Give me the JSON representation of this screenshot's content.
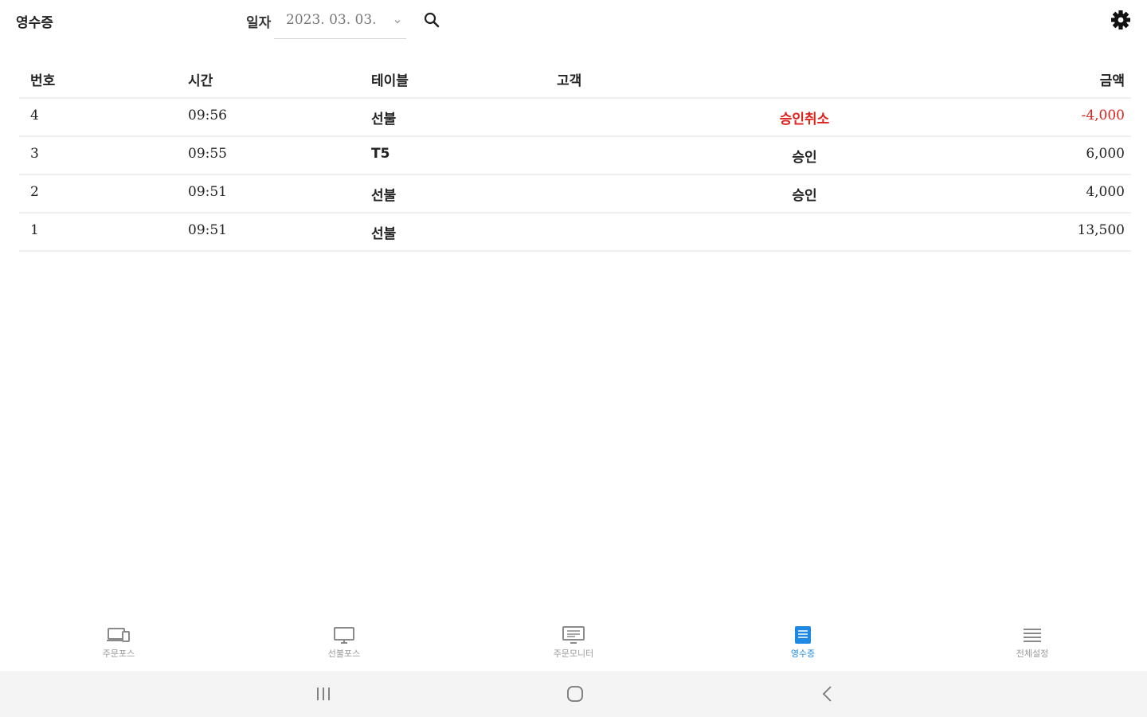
{
  "header": {
    "title": "영수증",
    "date_label": "일자",
    "date_value": "2023. 03. 03."
  },
  "table": {
    "columns": [
      "번호",
      "시간",
      "테이블",
      "고객",
      "금액"
    ],
    "rows": [
      {
        "no": "4",
        "time": "09:56",
        "table": "선불",
        "customer": "",
        "status": "승인취소",
        "amount": "-4,000",
        "cancelled": true
      },
      {
        "no": "3",
        "time": "09:55",
        "table": "T5",
        "customer": "",
        "status": "승인",
        "amount": "6,000",
        "cancelled": false
      },
      {
        "no": "2",
        "time": "09:51",
        "table": "선불",
        "customer": "",
        "status": "승인",
        "amount": "4,000",
        "cancelled": false
      },
      {
        "no": "1",
        "time": "09:51",
        "table": "선불",
        "customer": "",
        "status": "",
        "amount": "13,500",
        "cancelled": false
      }
    ]
  },
  "bottom_nav": {
    "items": [
      {
        "label": "주문포스",
        "icon": "devices-icon",
        "active": false
      },
      {
        "label": "선불포스",
        "icon": "monitor-icon",
        "active": false
      },
      {
        "label": "주문모니터",
        "icon": "order-monitor-icon",
        "active": false
      },
      {
        "label": "영수증",
        "icon": "receipt-icon",
        "active": true
      },
      {
        "label": "전체설정",
        "icon": "menu-list-icon",
        "active": false
      }
    ]
  },
  "colors": {
    "accent": "#1e88e5",
    "cancel_red": "#e0201a",
    "divider": "#f0f0f0",
    "system_bar": "#f4f4f4"
  }
}
